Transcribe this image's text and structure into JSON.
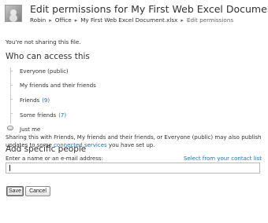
{
  "header": {
    "title": "Edit permissions for My First Web Excel Document.xlsx",
    "breadcrumb": {
      "items": [
        "Robin",
        "Office",
        "My First Web Excel Document.xlsx"
      ],
      "current": "Edit permissions",
      "separator": "▸"
    },
    "avatar_icon": "user-avatar-icon"
  },
  "status_text": "You're not sharing this file.",
  "access_section": {
    "title": "Who can access this",
    "options": [
      {
        "label": "Everyone (public)",
        "count": ""
      },
      {
        "label": "My friends and their friends",
        "count": ""
      },
      {
        "label": "Friends",
        "count": "(9)"
      },
      {
        "label": "Some friends",
        "count": "(7)"
      },
      {
        "label": "Just me",
        "count": ""
      }
    ],
    "selected": "Just me"
  },
  "info": {
    "prefix": "Sharing this with Friends, My friends and their friends, or Everyone (public) may also publish updates to some",
    "link": "connected services",
    "suffix": "you have set up."
  },
  "specific_section": {
    "title": "Add specific people",
    "input_label": "Enter a name or an e-mail address:",
    "contact_link": "Select from your contact list",
    "input_value": ""
  },
  "buttons": {
    "save": "Save",
    "cancel": "Cancel"
  },
  "colors": {
    "link": "#1e6fc9",
    "text": "#333333",
    "background": "#ffffff"
  }
}
